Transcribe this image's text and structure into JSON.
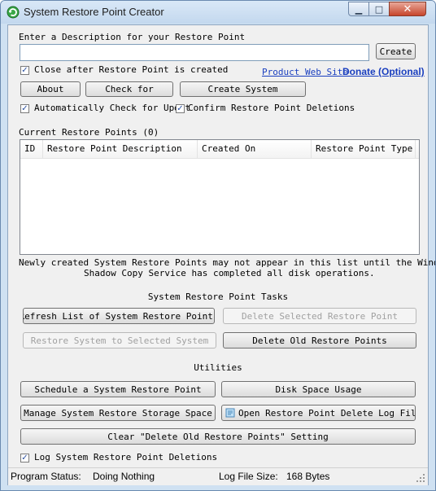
{
  "window": {
    "title": "System Restore Point Creator",
    "controls": {
      "minimize": "▁",
      "maximize": "□",
      "close": "✕"
    }
  },
  "description": {
    "label": "Enter a Description for your Restore Point",
    "value": "",
    "create_button": "Create"
  },
  "options": {
    "close_after": {
      "label": "Close after Restore Point is created",
      "checked": true
    },
    "auto_check": {
      "label": "Automatically Check for Updat",
      "checked": true
    },
    "confirm_deletions": {
      "label": "Confirm Restore Point Deletions",
      "checked": true
    }
  },
  "links": {
    "product_site": "Product Web Site",
    "donate": "Donate (Optional)"
  },
  "top_buttons": {
    "about": "About",
    "check_for": "Check for",
    "create_system": "Create System"
  },
  "restore_points": {
    "label": "Current Restore Points (0)",
    "columns": [
      "ID",
      "Restore Point Description",
      "Created On",
      "Restore Point Type"
    ],
    "rows": []
  },
  "note": {
    "line1": "Newly created System Restore Points may not appear in this list until the Windows",
    "line2": "Shadow Copy Service has completed all disk operations."
  },
  "tasks": {
    "heading": "System Restore Point Tasks",
    "refresh": "Refresh List of System Restore Points",
    "delete_selected": "Delete Selected Restore Point",
    "restore_selected": "Restore System to Selected System",
    "delete_old": "Delete Old Restore Points"
  },
  "utilities": {
    "heading": "Utilities",
    "schedule": "Schedule a System Restore Point",
    "disk_space": "Disk Space Usage",
    "manage_storage": "Manage System Restore Storage Space",
    "open_log": "Open Restore Point Delete Log File",
    "clear_setting": "Clear \"Delete Old Restore Points\" Setting"
  },
  "log_deletions": {
    "label": "Log System Restore Point Deletions",
    "checked": true
  },
  "status": {
    "program_status_label": "Program Status:",
    "program_status_value": "Doing Nothing",
    "log_size_label": "Log File Size:",
    "log_size_value": "168 Bytes"
  },
  "icons": {
    "app": "restore-arrow-icon",
    "check": "✓",
    "log_file": "log-file-icon",
    "grip": "resize-grip-icon"
  },
  "colors": {
    "link": "#1a3fbf",
    "title_bar": "#cfe1f2",
    "close_button": "#c7452c"
  }
}
